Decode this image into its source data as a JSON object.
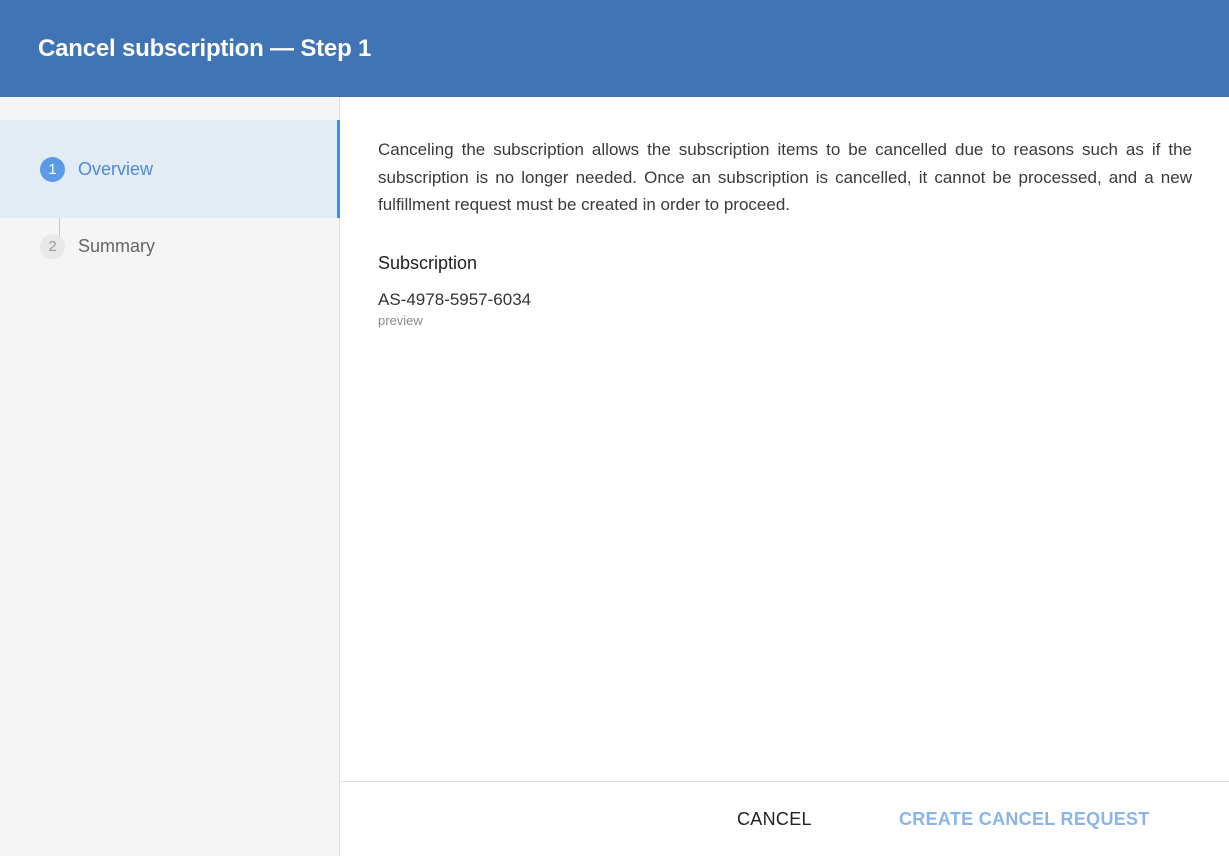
{
  "dialog": {
    "title": "Cancel subscription — Step 1"
  },
  "steps": [
    {
      "number": "1",
      "label": "Overview",
      "state": "active"
    },
    {
      "number": "2",
      "label": "Summary",
      "state": "inactive"
    }
  ],
  "content": {
    "description": "Canceling the subscription allows the subscription items to be cancelled due to reasons such as if the subscription is no longer needed. Once an subscription is cancelled, it cannot be processed, and a new fulfillment request must be created in order to proceed.",
    "subscription_label": "Subscription",
    "subscription_id": "AS-4978-5957-6034",
    "subscription_sub": "preview"
  },
  "footer": {
    "cancel_label": "CANCEL",
    "create_label": "CREATE CANCEL REQUEST"
  },
  "colors": {
    "header_bg": "#4074b4",
    "accent": "#4a8ad9",
    "disabled_action": "#8ab4e8"
  }
}
